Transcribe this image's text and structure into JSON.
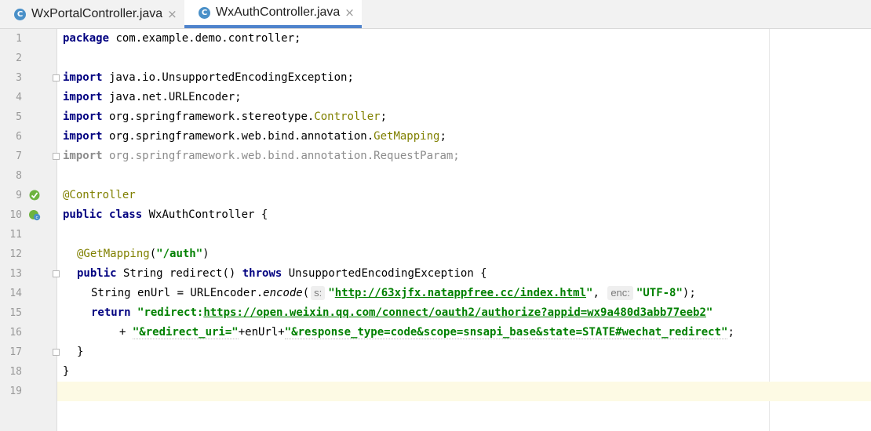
{
  "tabs": [
    {
      "label": "WxPortalController.java",
      "icon": "C",
      "close": "×"
    },
    {
      "label": "WxAuthController.java",
      "icon": "C",
      "close": "×",
      "active": true
    }
  ],
  "line_numbers": [
    "1",
    "2",
    "3",
    "4",
    "5",
    "6",
    "7",
    "8",
    "9",
    "10",
    "11",
    "12",
    "13",
    "14",
    "15",
    "16",
    "17",
    "18",
    "19"
  ],
  "code": {
    "l1_kw": "package",
    "l1_rest": " com.example.demo.controller;",
    "l3_kw": "import",
    "l3_rest": " java.io.UnsupportedEncodingException;",
    "l4_kw": "import",
    "l4_rest": " java.net.URLEncoder;",
    "l5_kw": "import",
    "l5_rest": " org.springframework.stereotype.",
    "l5_cls": "Controller",
    "l5_end": ";",
    "l6_kw": "import",
    "l6_rest": " org.springframework.web.bind.annotation.",
    "l6_cls": "GetMapping",
    "l6_end": ";",
    "l7_kw": "import",
    "l7_rest": " org.springframework.web.bind.annotation.RequestParam;",
    "l9_ann": "@Controller",
    "l10_kw1": "public",
    "l10_kw2": "class",
    "l10_rest": " WxAuthController {",
    "l12_ann": "@GetMapping",
    "l12_open": "(",
    "l12_str": "\"/auth\"",
    "l12_close": ")",
    "l13_kw1": "public",
    "l13_mid": " String redirect() ",
    "l13_kw2": "throws",
    "l13_rest": " UnsupportedEncodingException {",
    "l14_pre": "String enUrl = URLEncoder.",
    "l14_method": "encode",
    "l14_paren": "(",
    "l14_hint1": "s:",
    "l14_q1": "\"",
    "l14_url": "http://63xjfx.natappfree.cc/index.html",
    "l14_q2": "\"",
    "l14_comma": ", ",
    "l14_hint2": "enc:",
    "l14_enc": "\"UTF-8\"",
    "l14_end": ");",
    "l15_kw": "return",
    "l15_q1": "\"redirect:",
    "l15_url": "https://open.weixin.qq.com/connect/oauth2/authorize?appid=wx9a480d3abb77eeb2",
    "l15_q2": "\"",
    "l16_plus": "+ ",
    "l16_str1": "\"&redirect_uri=\"",
    "l16_mid": "+enUrl+",
    "l16_str2": "\"&response_type=code&scope=snsapi_base&state=STATE#wechat_redirect\"",
    "l16_end": ";",
    "l17": "}",
    "l18": "}"
  },
  "colors": {
    "keyword": "#000080",
    "string": "#008000",
    "annotation": "#808000",
    "unused": "#8c8c8c",
    "current_line": "#fdfae4",
    "tab_underline": "#4f83cc"
  }
}
